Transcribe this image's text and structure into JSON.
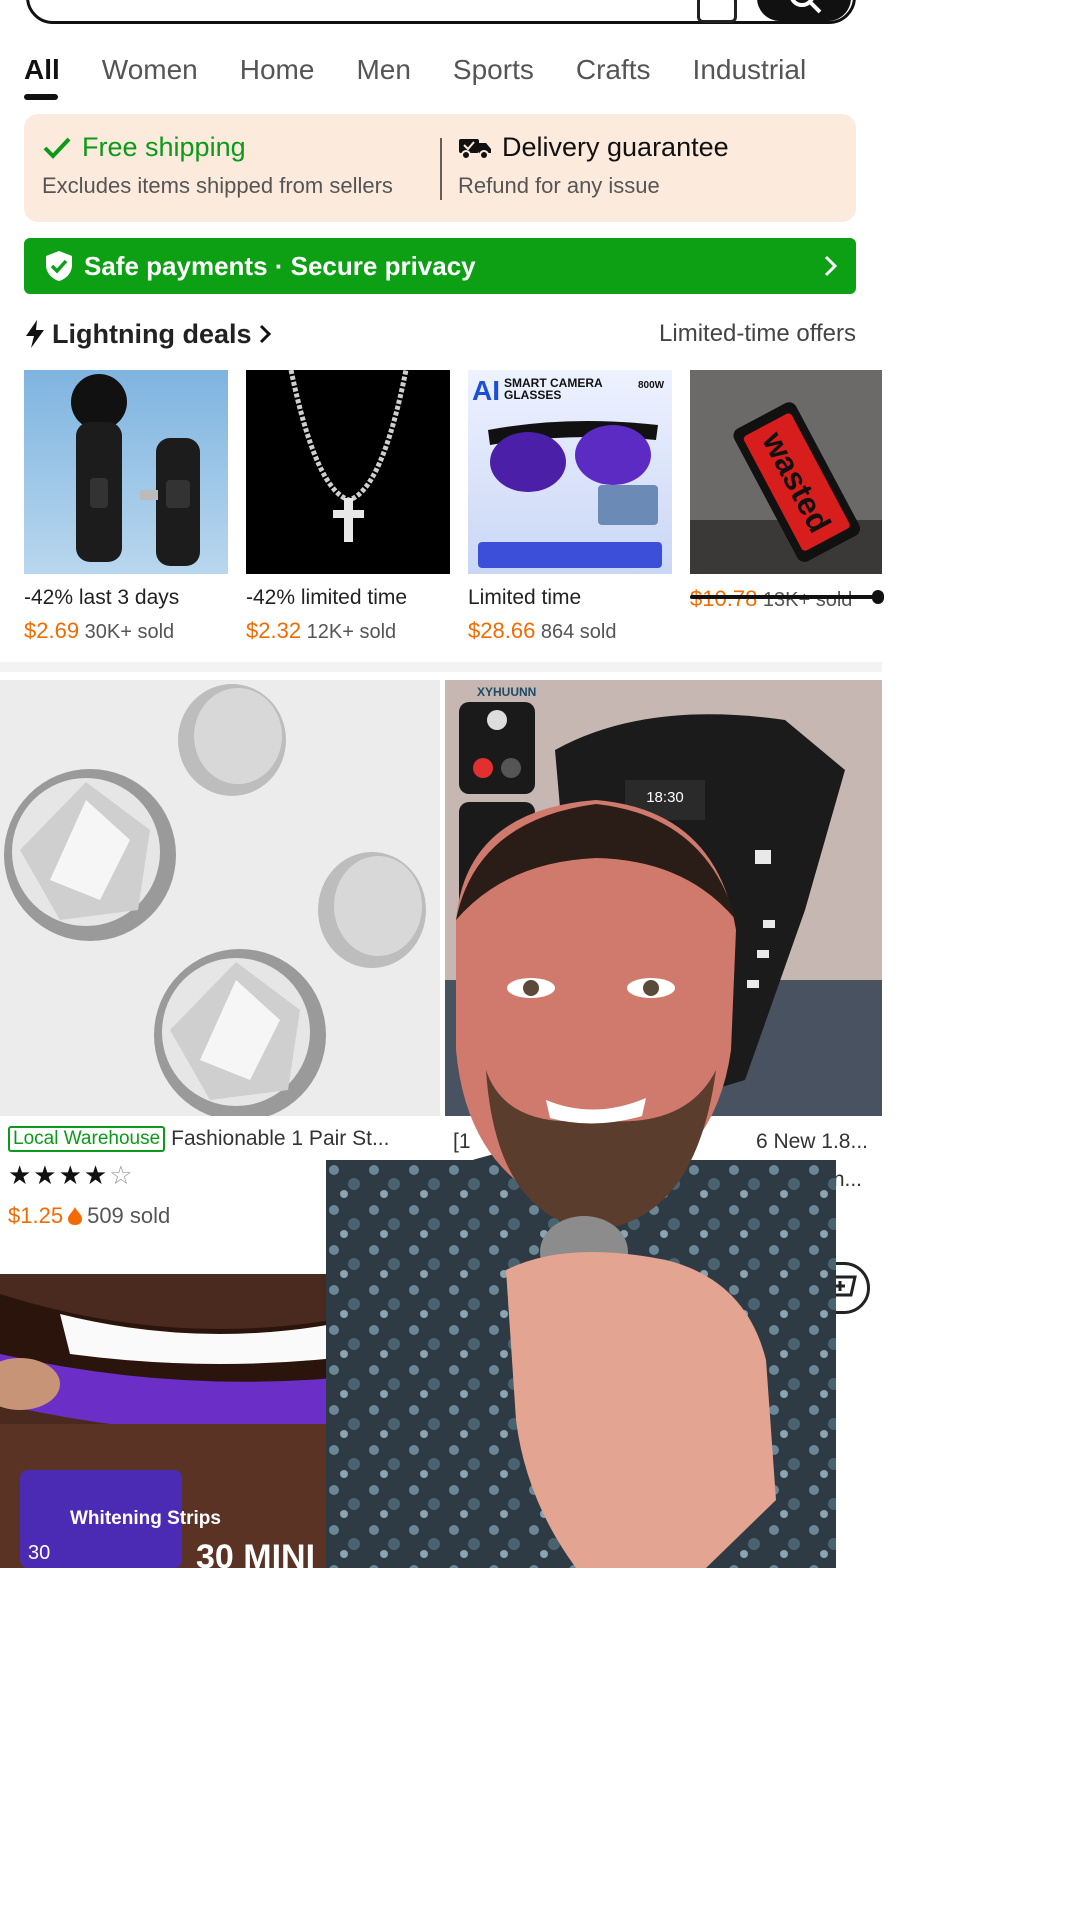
{
  "tabs": [
    {
      "label": "All",
      "active": true
    },
    {
      "label": "Women"
    },
    {
      "label": "Home"
    },
    {
      "label": "Men"
    },
    {
      "label": "Sports"
    },
    {
      "label": "Crafts"
    },
    {
      "label": "Industrial"
    }
  ],
  "shipping": {
    "free_title": "Free shipping",
    "free_sub": "Excludes items shipped from sellers",
    "delivery_title": "Delivery guarantee",
    "delivery_sub": "Refund for any issue"
  },
  "safe_payments": {
    "label": "Safe payments · Secure privacy"
  },
  "lightning": {
    "title": "Lightning deals",
    "more": "Limited-time offers",
    "items": [
      {
        "label": "-42% last 3 days",
        "currency": "$",
        "price": "2.69",
        "sold": "30K+ sold",
        "icon": "wireless-microphone"
      },
      {
        "label": "-42% limited time",
        "currency": "$",
        "price": "2.32",
        "sold": "12K+ sold",
        "icon": "cross-necklace"
      },
      {
        "label": "Limited time",
        "currency": "$",
        "price": "28.66",
        "sold": "864 sold",
        "icon": "camera-glasses"
      },
      {
        "label": "",
        "currency": "$",
        "price": "10.78",
        "sold": "13K+ sold",
        "icon": "wasted-rug"
      }
    ],
    "glasses_text": {
      "brand": "AI",
      "line1": "SMART CAMERA",
      "line2": "GLASSES",
      "mp": "800W"
    },
    "rug_text": "wasted"
  },
  "products": [
    {
      "badge": "Local Warehouse",
      "title": "Fashionable 1 Pair St...",
      "rating": 4,
      "currency": "$",
      "price": "1.25",
      "sold": "509 sold"
    },
    {
      "title_prefix": "[1",
      "title_suffix": "6 New 1.8...",
      "title_line2": "n...",
      "watch_time": "18:30",
      "watch_brand": "XYHUUNN"
    }
  ],
  "whitening": {
    "pack_label": "Whitening Strips",
    "pack_count": "30",
    "banner": "30 MINI"
  },
  "rating_stars": {
    "filled": "★★★★",
    "empty": "☆"
  }
}
